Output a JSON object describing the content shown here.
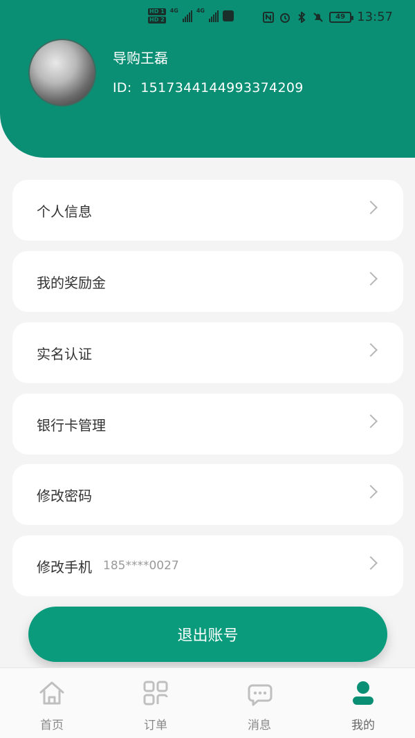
{
  "status_bar": {
    "hd_badges": [
      "HD 1",
      "HD 2"
    ],
    "network": [
      "4G",
      "4G"
    ],
    "battery": "49",
    "time": "13:57"
  },
  "profile": {
    "name": "导购王磊",
    "id_label": "ID:",
    "id_value": "1517344144993374209"
  },
  "menu": [
    {
      "label": "个人信息"
    },
    {
      "label": "我的奖励金"
    },
    {
      "label": "实名认证"
    },
    {
      "label": "银行卡管理"
    },
    {
      "label": "修改密码"
    },
    {
      "label": "修改手机",
      "extra": "185****0027"
    }
  ],
  "logout_label": "退出账号",
  "tabs": [
    {
      "label": "首页",
      "icon": "home-icon"
    },
    {
      "label": "订单",
      "icon": "grid-icon"
    },
    {
      "label": "消息",
      "icon": "chat-icon"
    },
    {
      "label": "我的",
      "icon": "user-icon"
    }
  ],
  "colors": {
    "brand": "#0a8f74",
    "button": "#0a9b7c",
    "inactive_icon": "#bfbfbf"
  }
}
